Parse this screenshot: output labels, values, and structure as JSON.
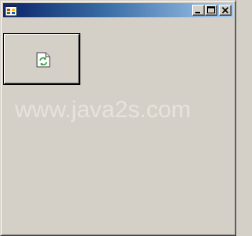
{
  "window": {
    "title": "",
    "controls": {
      "minimize_icon": "minimize-icon",
      "maximize_icon": "maximize-icon",
      "close_icon": "close-icon"
    }
  },
  "main_button": {
    "icon": "refresh-document-icon",
    "label": ""
  },
  "watermark": {
    "text": "www.java2s.com"
  },
  "colors": {
    "face": "#d4d0c8",
    "titlebar_start": "#0a246a",
    "titlebar_end": "#a6caf0",
    "watermark": "#e6e3dd"
  }
}
